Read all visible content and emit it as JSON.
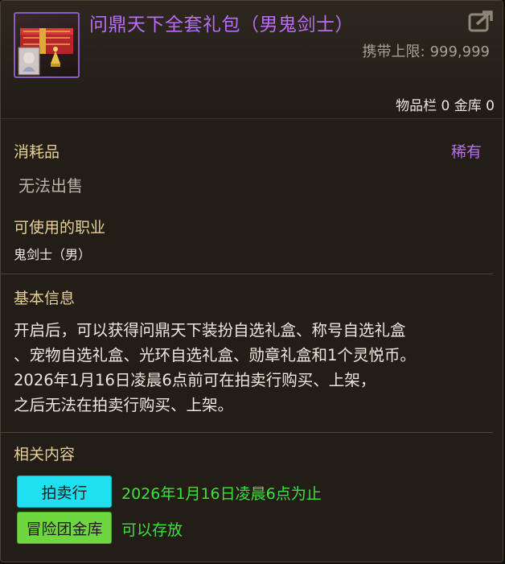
{
  "item": {
    "title": "问鼎天下全套礼包（男鬼剑士）",
    "carry_limit_label": "携带上限:",
    "carry_limit_value": "999,999",
    "storage_text": "物品栏 0 金库 0",
    "icon": "gift-box-icon",
    "rarity_color": "#b86ef2"
  },
  "info": {
    "category": "消耗品",
    "rarity": "稀有",
    "trade_status": "无法出售",
    "job_title": "可使用的职业",
    "job_value": "鬼剑士（男）",
    "basic_title": "基本信息",
    "description_lines": [
      "开启后，可以获得问鼎天下装扮自选礼盒、称号自选礼盒",
      "、宠物自选礼盒、光环自选礼盒、勋章礼盒和1个灵悦币。",
      "2026年1月16日凌晨6点前可在拍卖行购买、上架，",
      "之后无法在拍卖行购买、上架。"
    ]
  },
  "related": {
    "title": "相关内容",
    "auction_label": "拍卖行",
    "auction_note": "2026年1月16日凌晨6点为止",
    "auction_color": "#1fe0ef",
    "vault_label": "冒险团金库",
    "vault_note": "可以存放",
    "vault_color": "#6ed63f",
    "note_color": "#3ee13b"
  },
  "icons": {
    "export": "export-icon"
  }
}
